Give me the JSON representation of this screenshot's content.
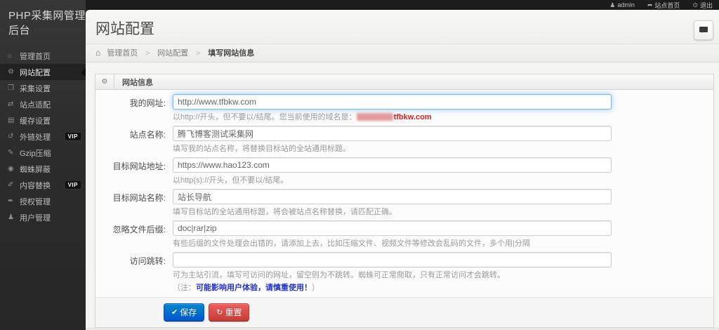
{
  "topbar": {
    "user": "admin",
    "site_home": "站点首页",
    "logout": "退出"
  },
  "sidebar": {
    "logo": "PHP采集网管理后台",
    "vip_label": "VIP",
    "items": [
      {
        "id": "home",
        "label": "管理首页",
        "icon": "home-icon",
        "active": false,
        "vip": false
      },
      {
        "id": "site-config",
        "label": "网站配置",
        "icon": "gear-icon",
        "active": true,
        "vip": false
      },
      {
        "id": "collect",
        "label": "采集设置",
        "icon": "collect-icon",
        "active": false,
        "vip": false
      },
      {
        "id": "adapt",
        "label": "站点适配",
        "icon": "shuffle-icon",
        "active": false,
        "vip": false
      },
      {
        "id": "cache",
        "label": "缓存设置",
        "icon": "cache-icon",
        "active": false,
        "vip": false
      },
      {
        "id": "extlink",
        "label": "外链处理",
        "icon": "extlink-icon",
        "active": false,
        "vip": true
      },
      {
        "id": "gzip",
        "label": "Gzip压缩",
        "icon": "pencil-icon",
        "active": false,
        "vip": false
      },
      {
        "id": "spider",
        "label": "蜘蛛屏蔽",
        "icon": "spider-icon",
        "active": false,
        "vip": false
      },
      {
        "id": "replace",
        "label": "内容替换",
        "icon": "replace-icon",
        "active": false,
        "vip": true
      },
      {
        "id": "auth",
        "label": "授权管理",
        "icon": "auth-icon",
        "active": false,
        "vip": false
      },
      {
        "id": "user",
        "label": "用户管理",
        "icon": "user-icon",
        "active": false,
        "vip": false
      }
    ]
  },
  "page": {
    "title": "网站配置"
  },
  "breadcrumb": {
    "items": [
      "管理首页",
      "网站配置",
      "填写网站信息"
    ],
    "separator": ">"
  },
  "panel": {
    "title": "网站信息"
  },
  "form": {
    "fields": [
      {
        "id": "my-url",
        "label": "我的网址:",
        "value": "http://www.tfbkw.com",
        "help_prefix": "以http://开头，但不要以/结尾。您当前使用的域名是：",
        "help_domain": "tfbkw.com"
      },
      {
        "id": "site-name",
        "label": "站点名称:",
        "value": "腾飞博客测试采集网",
        "help": "填写我的站点名称，将替换目标站的全站通用标题。"
      },
      {
        "id": "target-url",
        "label": "目标网站地址:",
        "value": "https://www.hao123.com",
        "help": "以http(s)://开头，但不要以/结尾。"
      },
      {
        "id": "target-name",
        "label": "目标网站名称:",
        "value": "站长导航",
        "help": "填写目标站的全站通用标题，将会被站点名称替换，请匹配正确。"
      },
      {
        "id": "ignore-ext",
        "label": "忽略文件后缀:",
        "value": "doc|rar|zip",
        "help": "有些后缀的文件处理会出错的，请添加上去，比如压缩文件、视频文件等修改会乱码的文件，多个用|分隔"
      },
      {
        "id": "redirect",
        "label": "访问跳转:",
        "value": "",
        "help": "可为主站引流，填写可访问的网址，留空则为不跳转。蜘蛛可正常爬取，只有正常访问才会跳转。",
        "note_prefix": "（注：",
        "note_warning": "可能影响用户体验，请慎重使用！",
        "note_suffix": "）"
      }
    ],
    "actions": {
      "save": "保存",
      "reset": "重置"
    }
  },
  "icon_glyphs": {
    "home-icon": "⌂",
    "gear-icon": "⚙",
    "collect-icon": "❐",
    "shuffle-icon": "⇄",
    "cache-icon": "▤",
    "extlink-icon": "↺",
    "pencil-icon": "✎",
    "spider-icon": "◉",
    "replace-icon": "✐",
    "auth-icon": "✒",
    "user-icon": "♟",
    "share-arrow-icon": "➦",
    "power-icon": "⊙",
    "check-icon": "✔",
    "refresh-icon": "↻"
  },
  "colors": {
    "sidebar_bg": "#2e2e2e",
    "vip_bg": "#111111",
    "save_blue": "#0072cc",
    "reset_red": "#c43c35",
    "domain_red": "#cc2222",
    "warning_blue": "#2233cc",
    "help_gray": "#9a9a9a"
  }
}
